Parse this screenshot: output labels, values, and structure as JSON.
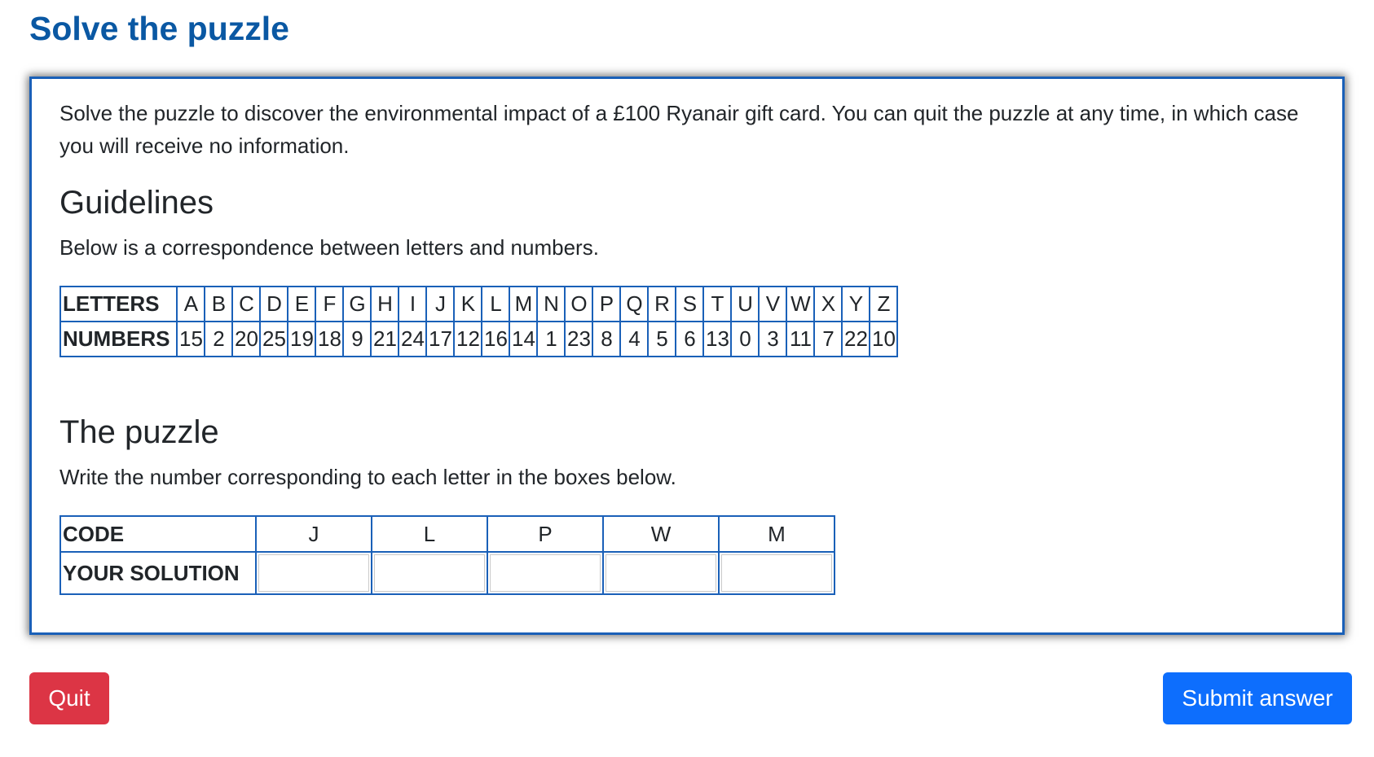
{
  "page": {
    "title": "Solve the puzzle"
  },
  "card": {
    "intro": "Solve the puzzle to discover the environmental impact of a £100 Ryanair gift card. You can quit the puzzle at any time, in which case you will receive no information.",
    "guidelines": {
      "heading": "Guidelines",
      "text": "Below is a correspondence between letters and numbers.",
      "letters_label": "LETTERS",
      "numbers_label": "NUMBERS",
      "letters": [
        "A",
        "B",
        "C",
        "D",
        "E",
        "F",
        "G",
        "H",
        "I",
        "J",
        "K",
        "L",
        "M",
        "N",
        "O",
        "P",
        "Q",
        "R",
        "S",
        "T",
        "U",
        "V",
        "W",
        "X",
        "Y",
        "Z"
      ],
      "numbers": [
        "15",
        "2",
        "20",
        "25",
        "19",
        "18",
        "9",
        "21",
        "24",
        "17",
        "12",
        "16",
        "14",
        "1",
        "23",
        "8",
        "4",
        "5",
        "6",
        "13",
        "0",
        "3",
        "11",
        "7",
        "22",
        "10"
      ]
    },
    "puzzle": {
      "heading": "The puzzle",
      "text": "Write the number corresponding to each letter in the boxes below.",
      "code_label": "CODE",
      "solution_label": "YOUR SOLUTION",
      "code": [
        "J",
        "L",
        "P",
        "W",
        "M"
      ],
      "solutions": [
        "",
        "",
        "",
        "",
        ""
      ]
    }
  },
  "actions": {
    "quit_label": "Quit",
    "submit_label": "Submit answer"
  },
  "colors": {
    "title": "#0a58a3",
    "border": "#1a60b8",
    "quit": "#dc3545",
    "submit": "#0d6efd"
  }
}
